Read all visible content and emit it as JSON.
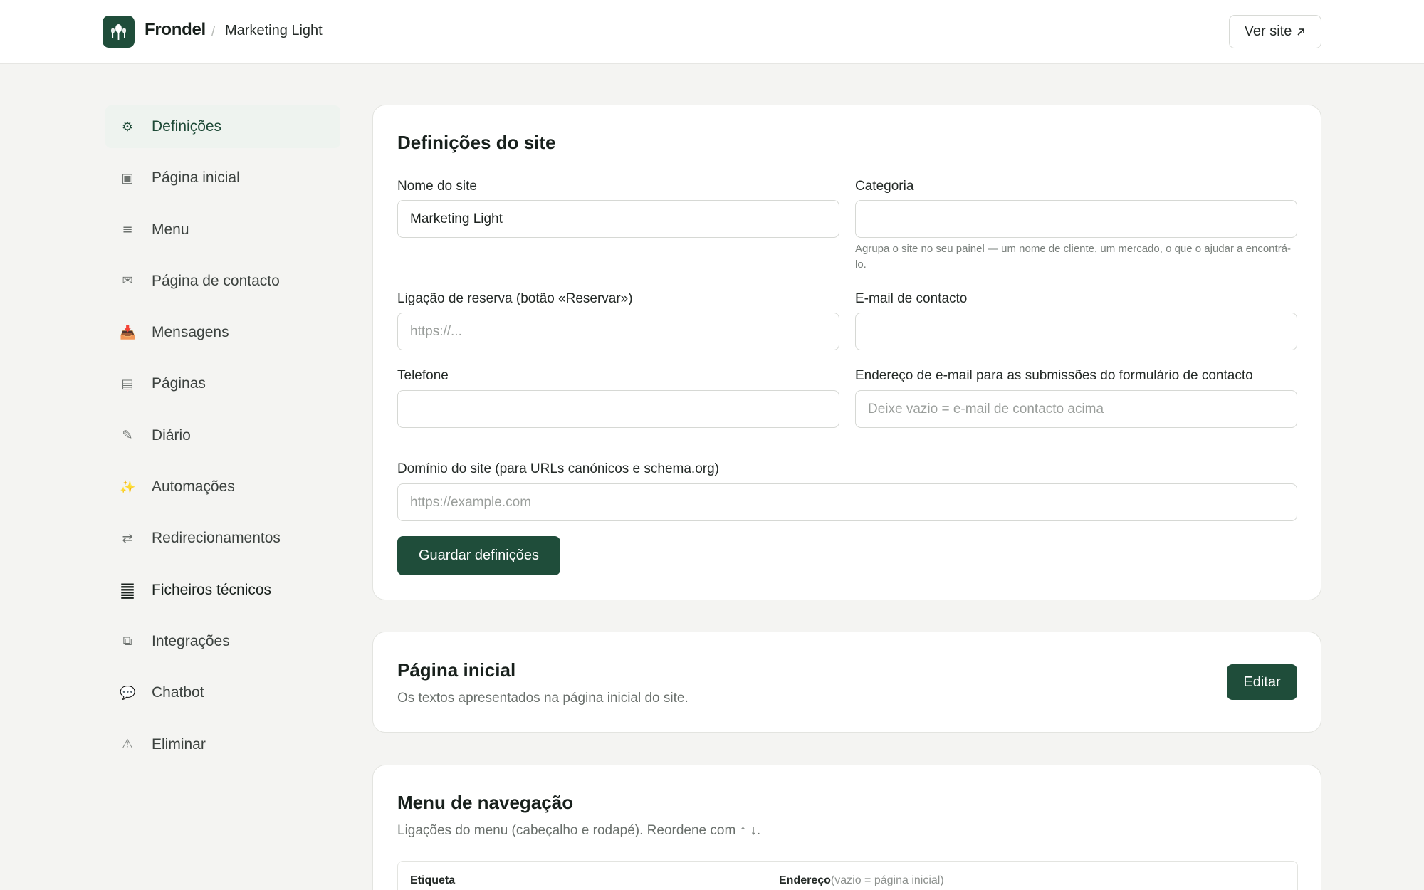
{
  "header": {
    "brand": "Frondel",
    "separator": "/",
    "site_name": "Marketing Light",
    "view_site_label": "Ver site",
    "view_site_icon": "arrow-up-right-icon"
  },
  "sidebar": {
    "items": [
      {
        "icon": "⚙",
        "label": "Definições"
      },
      {
        "icon": "▣",
        "label": "Página inicial"
      },
      {
        "icon": "≡",
        "label": "Menu"
      },
      {
        "icon": "✉",
        "label": "Página de contacto"
      },
      {
        "icon": "📥",
        "label": "Mensagens"
      },
      {
        "icon": "▤",
        "label": "Páginas"
      },
      {
        "icon": "✎",
        "label": "Diário"
      },
      {
        "icon": "✨",
        "label": "Automações"
      },
      {
        "icon": "⇄",
        "label": "Redirecionamentos"
      },
      {
        "icon": "䷀",
        "label": "Ficheiros técnicos"
      },
      {
        "icon": "⧉",
        "label": "Integrações"
      },
      {
        "icon": "💬",
        "label": "Chatbot"
      },
      {
        "icon": "⚠",
        "label": "Eliminar"
      }
    ]
  },
  "settings": {
    "title": "Definições do site",
    "site_name_label": "Nome do site",
    "site_name_value": "Marketing Light",
    "category_label": "Categoria",
    "category_value": "",
    "category_hint": "Agrupa o site no seu painel — um nome de cliente, um mercado, o que o ajudar a encontrá-lo.",
    "booking_label": "Ligação de reserva (botão «Reservar»)",
    "booking_placeholder": "https://...",
    "email_label": "E-mail de contacto",
    "email_value": "",
    "phone_label": "Telefone",
    "phone_value": "",
    "form_email_label": "Endereço de e-mail para as submissões do formulário de contacto",
    "form_email_placeholder": "Deixe vazio = e-mail de contacto acima",
    "domain_label": "Domínio do site (para URLs canónicos e schema.org)",
    "domain_placeholder": "https://example.com",
    "save_label": "Guardar definições"
  },
  "homepage": {
    "title": "Página inicial",
    "subtitle": "Os textos apresentados na página inicial do site.",
    "edit_label": "Editar"
  },
  "navmenu": {
    "title": "Menu de navegação",
    "subtitle": "Ligações do menu (cabeçalho e rodapé). Reordene com ↑ ↓.",
    "col_label": "Etiqueta",
    "col_address": "Endereço",
    "col_address_hint": "(vazio = página inicial)"
  },
  "colors": {
    "accent": "#1f4d3a",
    "active_bg": "#eef3ef",
    "page_bg": "#f4f4f2"
  }
}
